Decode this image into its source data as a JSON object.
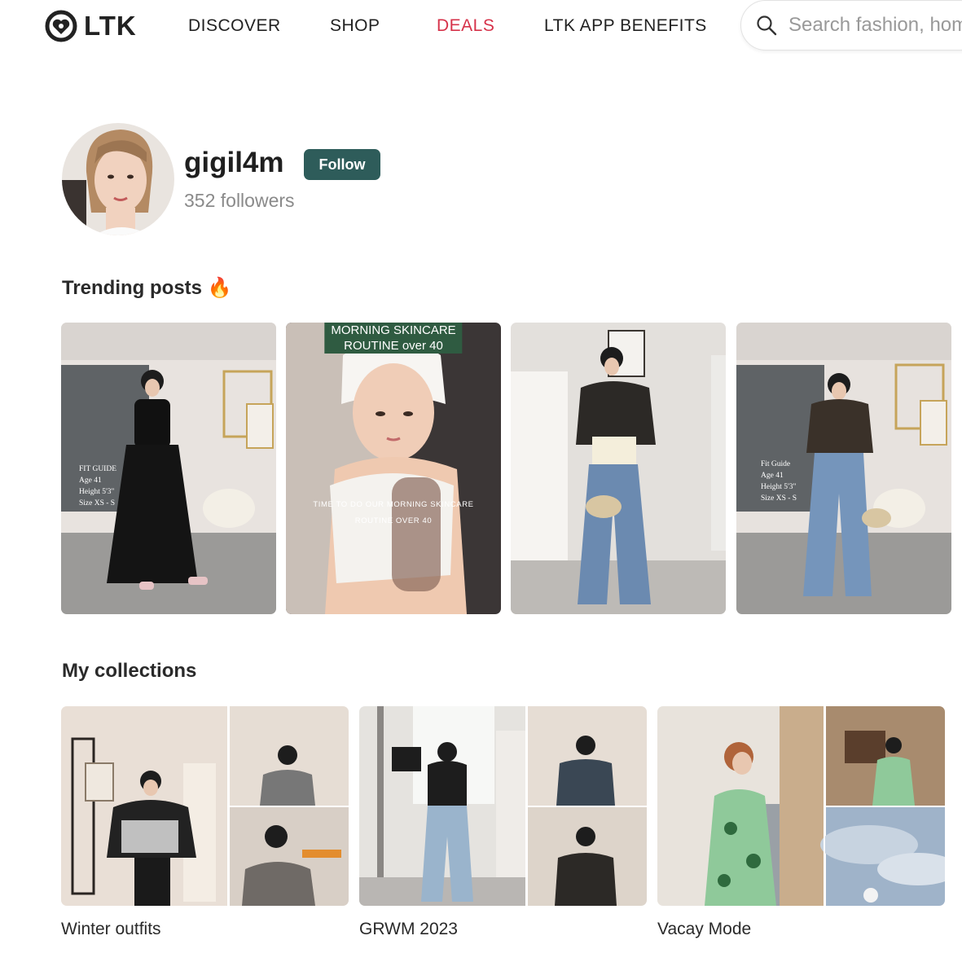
{
  "header": {
    "logo_text": "LTK",
    "nav": [
      "DISCOVER",
      "SHOP",
      "DEALS",
      "LTK APP BENEFITS"
    ],
    "search_placeholder": "Search fashion, home & more",
    "deals_color": "#d6324a"
  },
  "profile": {
    "username": "gigil4m",
    "follow_label": "Follow",
    "followers": "352 followers",
    "accent_color": "#2e5c5a"
  },
  "trending": {
    "title": "Trending posts",
    "emoji": "🔥",
    "posts": [
      {
        "fit_guide": [
          "FIT GUIDE",
          "Age 41",
          "Height 5'3\"",
          "Size XS - S"
        ]
      },
      {
        "banner": [
          "MORNING SKINCARE",
          "ROUTINE over 40"
        ],
        "caption": [
          "TIME TO DO OUR MORNING SKINCARE",
          "ROUTINE OVER 40"
        ]
      },
      {},
      {
        "fit_guide": [
          "Fit Guide",
          "Age 41",
          "Height 5'3\"",
          "Size XS - S"
        ]
      }
    ]
  },
  "collections": {
    "title": "My collections",
    "items": [
      {
        "label": "Winter outfits"
      },
      {
        "label": "GRWM 2023"
      },
      {
        "label": "Vacay Mode"
      }
    ]
  }
}
